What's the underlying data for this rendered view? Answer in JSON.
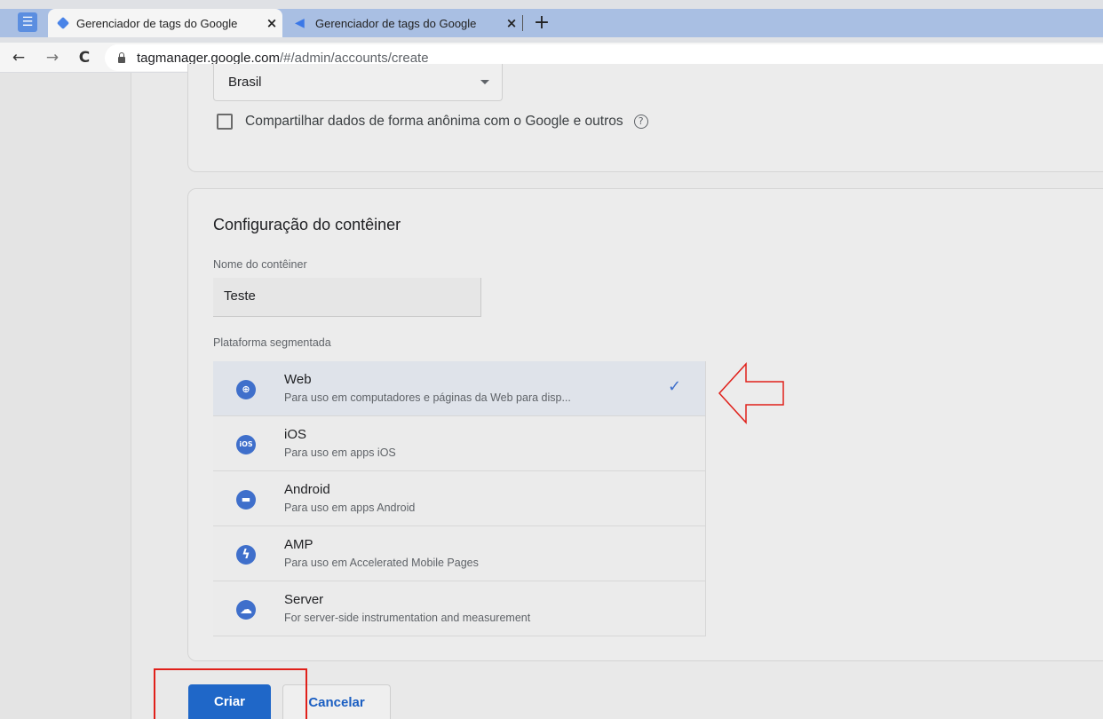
{
  "browser": {
    "tabs": [
      {
        "title": "Gerenciador de tags do Google",
        "close": "×"
      },
      {
        "title": "Gerenciador de tags do Google",
        "close": "×"
      }
    ],
    "new_tab": "+",
    "url_host": "tagmanager.google.com",
    "url_path": "/#/admin/accounts/create",
    "nav": {
      "back": "←",
      "forward": "→",
      "reload": "C"
    }
  },
  "account": {
    "country": "Brasil",
    "share_label": "Compartilhar dados de forma anônima com o Google e outros",
    "help": "?"
  },
  "container": {
    "section_title": "Configuração do contêiner",
    "name_label": "Nome do contêiner",
    "name_value": "Teste",
    "platform_label": "Plataforma segmentada",
    "platforms": [
      {
        "name": "Web",
        "desc": "Para uso em computadores e páginas da Web para disp...",
        "icon": "globe-icon",
        "glyph": "⊕",
        "selected": true
      },
      {
        "name": "iOS",
        "desc": "Para uso em apps iOS",
        "icon": "ios-icon",
        "glyph": "iOS",
        "selected": false
      },
      {
        "name": "Android",
        "desc": "Para uso em apps Android",
        "icon": "android-icon",
        "glyph": "▬",
        "selected": false
      },
      {
        "name": "AMP",
        "desc": "Para uso em Accelerated Mobile Pages",
        "icon": "lightning-icon",
        "glyph": "ϟ",
        "selected": false
      },
      {
        "name": "Server",
        "desc": "For server-side instrumentation and measurement",
        "icon": "cloud-icon",
        "glyph": "☁",
        "selected": false
      }
    ],
    "check": "✓"
  },
  "actions": {
    "create_label": "Criar",
    "cancel_label": "Cancelar"
  },
  "colors": {
    "primary": "#1f67c8",
    "annotation_red": "#e0201a",
    "icon_blue": "#3f6fcb"
  }
}
